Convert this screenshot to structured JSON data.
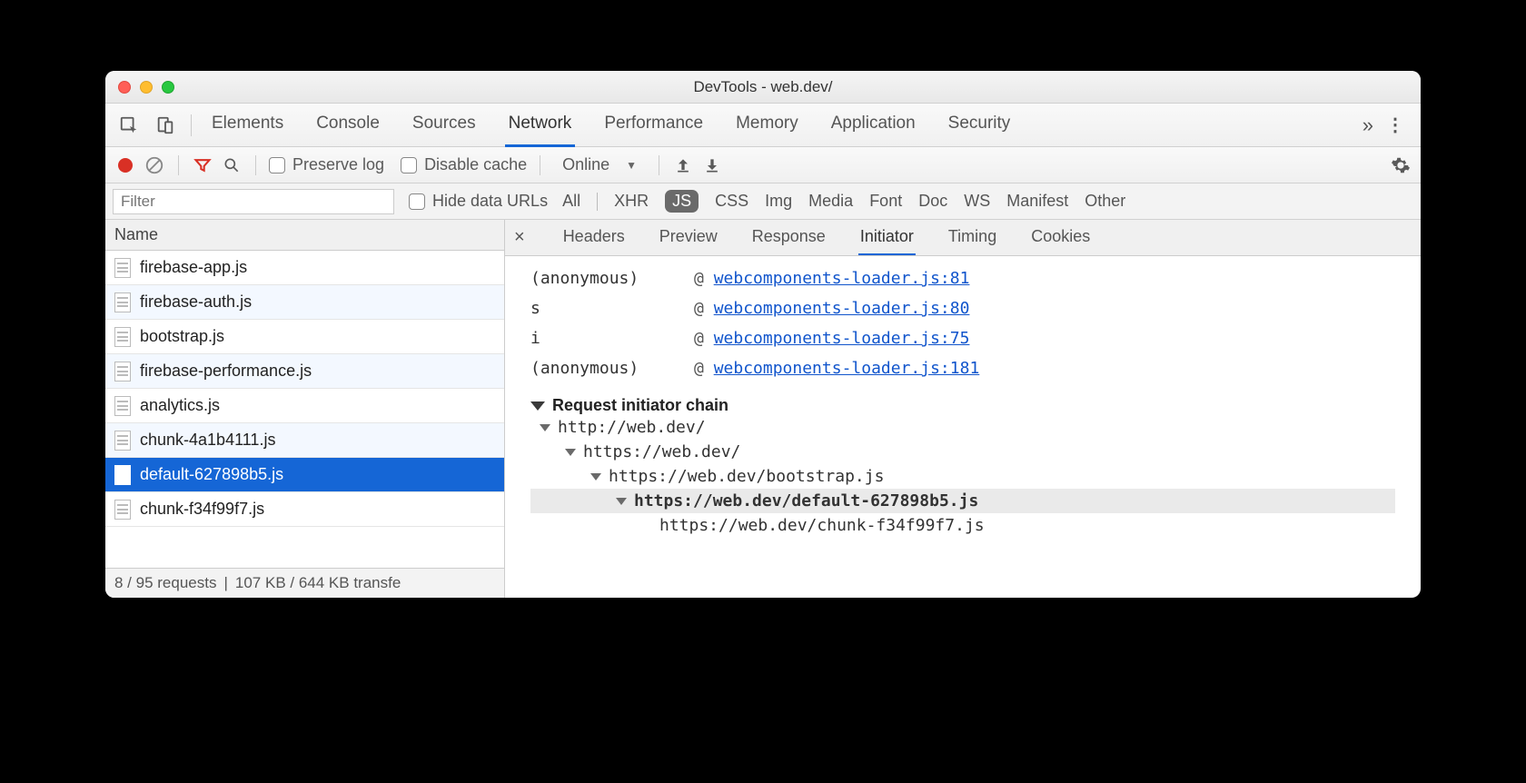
{
  "window": {
    "title": "DevTools - web.dev/"
  },
  "tabs": {
    "items": [
      "Elements",
      "Console",
      "Sources",
      "Network",
      "Performance",
      "Memory",
      "Application",
      "Security"
    ],
    "active": "Network",
    "overflow": "»"
  },
  "toolbar": {
    "preserve_log": "Preserve log",
    "disable_cache": "Disable cache",
    "online": "Online"
  },
  "filter": {
    "placeholder": "Filter",
    "hide_urls": "Hide data URLs",
    "chips": [
      "All",
      "XHR",
      "JS",
      "CSS",
      "Img",
      "Media",
      "Font",
      "Doc",
      "WS",
      "Manifest",
      "Other"
    ],
    "active_chip": "JS"
  },
  "list": {
    "header": "Name",
    "items": [
      {
        "name": "firebase-app.js",
        "selected": false
      },
      {
        "name": "firebase-auth.js",
        "selected": false,
        "stripe": true
      },
      {
        "name": "bootstrap.js",
        "selected": false
      },
      {
        "name": "firebase-performance.js",
        "selected": false,
        "stripe": true
      },
      {
        "name": "analytics.js",
        "selected": false
      },
      {
        "name": "chunk-4a1b4111.js",
        "selected": false,
        "stripe": true
      },
      {
        "name": "default-627898b5.js",
        "selected": true
      },
      {
        "name": "chunk-f34f99f7.js",
        "selected": false
      }
    ],
    "footer": {
      "count": "8 / 95 requests",
      "sep": "|",
      "size": "107 KB / 644 KB transfe"
    }
  },
  "detail": {
    "tabs": [
      "Headers",
      "Preview",
      "Response",
      "Initiator",
      "Timing",
      "Cookies"
    ],
    "active": "Initiator",
    "stack": [
      {
        "fn": "(anonymous)",
        "link": "webcomponents-loader.js:81"
      },
      {
        "fn": "s",
        "link": "webcomponents-loader.js:80"
      },
      {
        "fn": "i",
        "link": "webcomponents-loader.js:75"
      },
      {
        "fn": "(anonymous)",
        "link": "webcomponents-loader.js:181"
      }
    ],
    "at": "@",
    "chain_title": "Request initiator chain",
    "chain": [
      {
        "indent": 0,
        "text": "http://web.dev/",
        "expanded": true
      },
      {
        "indent": 1,
        "text": "https://web.dev/",
        "expanded": true
      },
      {
        "indent": 2,
        "text": "https://web.dev/bootstrap.js",
        "expanded": true
      },
      {
        "indent": 3,
        "text": "https://web.dev/default-627898b5.js",
        "expanded": true,
        "current": true
      },
      {
        "indent": 4,
        "text": "https://web.dev/chunk-f34f99f7.js"
      }
    ]
  }
}
